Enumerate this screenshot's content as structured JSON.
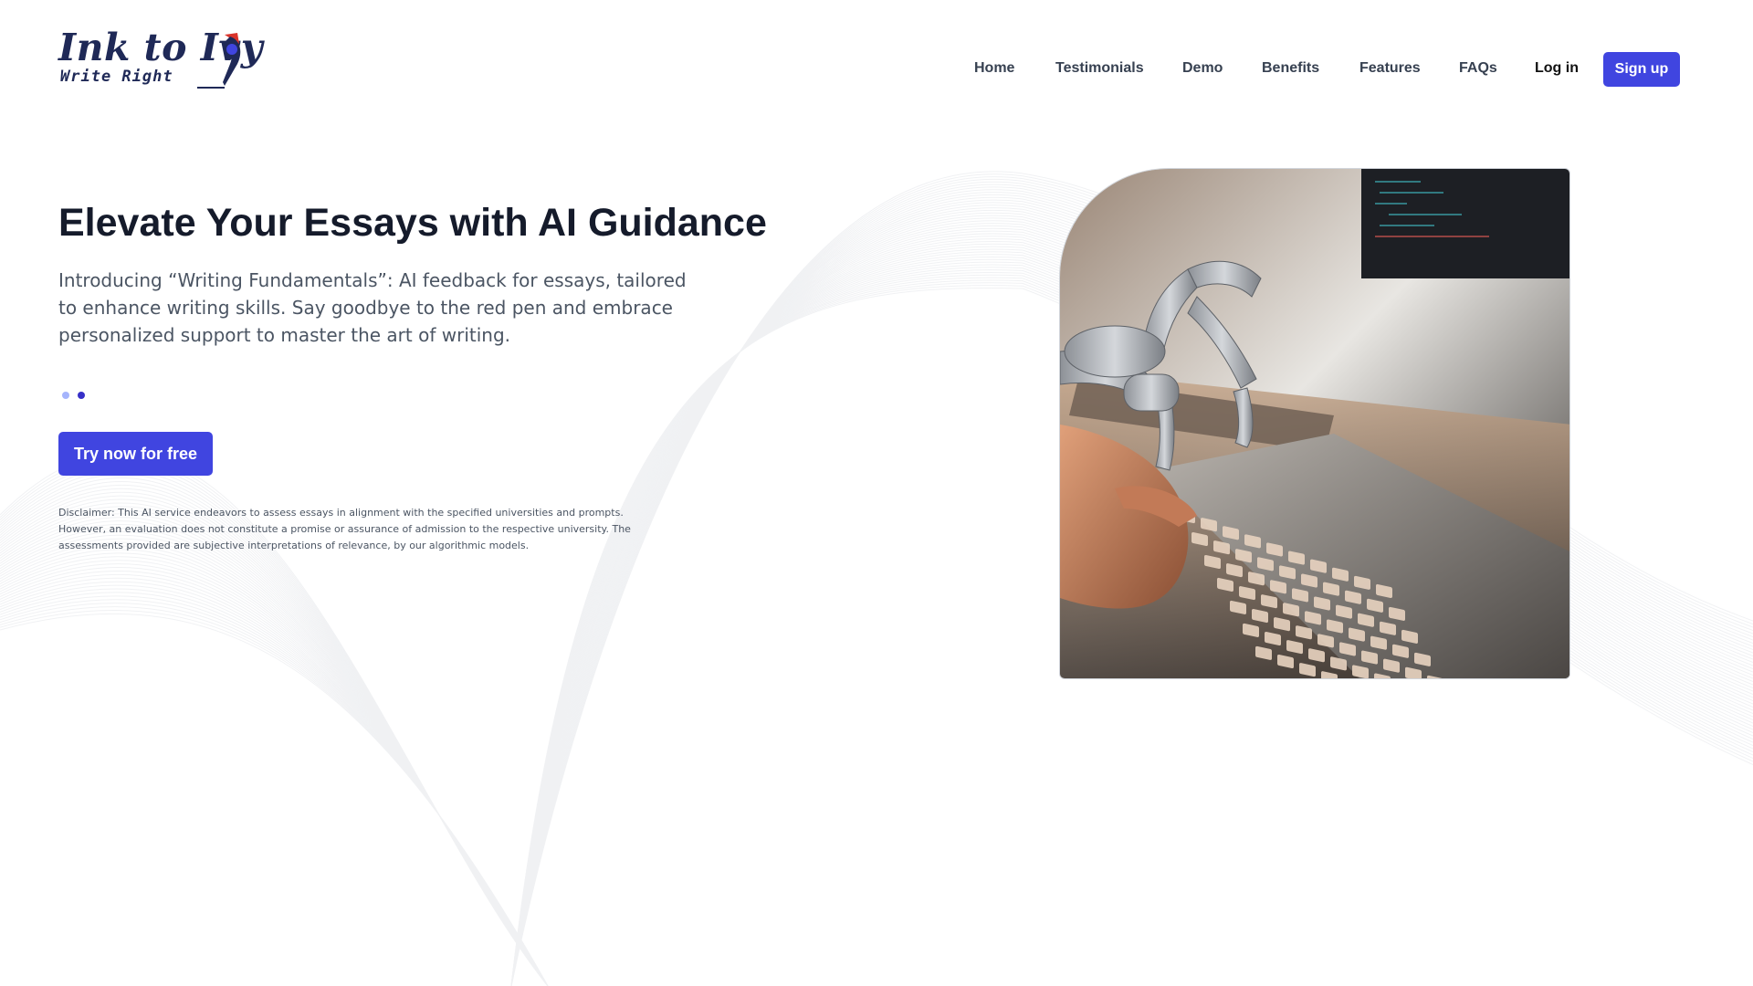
{
  "header": {
    "logo": {
      "title": "Ink to Ivy",
      "subtitle": "Write Right",
      "icon": "pen-nib-icon"
    },
    "nav": {
      "items": [
        {
          "label": "Home"
        },
        {
          "label": "Testimonials"
        },
        {
          "label": "Demo"
        },
        {
          "label": "Benefits"
        },
        {
          "label": "Features"
        },
        {
          "label": "FAQs"
        }
      ],
      "login_label": "Log in",
      "signup_label": "Sign up"
    }
  },
  "hero": {
    "title": "Elevate Your Essays with AI Guidance",
    "description": "Introducing “Writing Fundamentals”: AI feedback for essays, tailored to enhance writing skills. Say goodbye to the red pen and embrace personalized support to master the art of writing.",
    "carousel": {
      "count": 2,
      "active_index": 1
    },
    "cta_label": "Try now for free",
    "disclaimer": "Disclaimer: This AI service endeavors to assess essays in alignment with the specified universities and prompts. However, an evaluation does not constitute a promise or assurance of admission to the respective university. The assessments provided are subjective interpretations of relevance, by our algorithmic models.",
    "image": "robot-hand-typing-on-keyboard"
  },
  "colors": {
    "primary": "#4045e0",
    "heading": "#151b2b",
    "body_text": "#4b5563",
    "logo_navy": "#1f2957",
    "logo_red": "#d9342b",
    "dot_inactive": "#a5b4fc",
    "dot_active": "#3730c8"
  }
}
